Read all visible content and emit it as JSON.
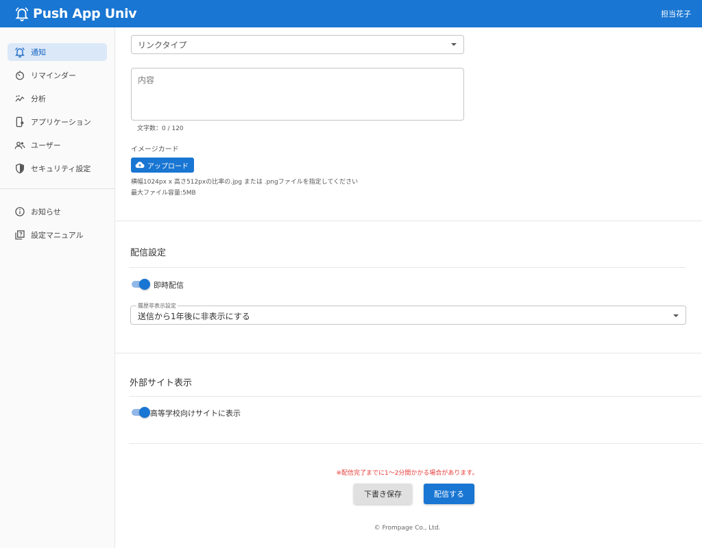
{
  "header": {
    "app_title": "Push App Univ",
    "user_name": "担当花子",
    "color": "#1976d2"
  },
  "sidebar": {
    "items": [
      {
        "label": "通知",
        "icon": "bell-icon",
        "active": true
      },
      {
        "label": "リマインダー",
        "icon": "timer-icon"
      },
      {
        "label": "分析",
        "icon": "analytics-icon"
      },
      {
        "label": "アプリケーション",
        "icon": "mobile-app-icon"
      },
      {
        "label": "ユーザー",
        "icon": "users-icon"
      },
      {
        "label": "セキュリティ設定",
        "icon": "shield-icon"
      }
    ],
    "secondary_items": [
      {
        "label": "お知らせ",
        "icon": "info-icon"
      },
      {
        "label": "設定マニュアル",
        "icon": "manual-icon"
      }
    ]
  },
  "form": {
    "link_type": {
      "placeholder": "リンクタイプ"
    },
    "content": {
      "placeholder": "内容",
      "char_count": "文字数：0 / 120"
    },
    "image_card": {
      "label": "イメージカード",
      "upload_label": "アップロード",
      "hint_line1": "横幅1024px x 高さ512pxの比率の.jpg または .pngファイルを指定してください",
      "hint_line2": "最大ファイル容量:5MB"
    }
  },
  "delivery": {
    "title": "配信設定",
    "immediate": {
      "label": "即時配信",
      "checked": true
    },
    "history": {
      "legend": "履歴非表示設定",
      "value": "送信から1年後に非表示にする"
    }
  },
  "external": {
    "title": "外部サイト表示",
    "high_school": {
      "label": "高等学校向けサイトに表示",
      "checked": true
    }
  },
  "actions": {
    "warning": "※配信完了までに1〜2分間かかる場合があります。",
    "draft_label": "下書き保存",
    "send_label": "配信する"
  },
  "footer": {
    "copyright": "© Frompage Co., Ltd."
  }
}
